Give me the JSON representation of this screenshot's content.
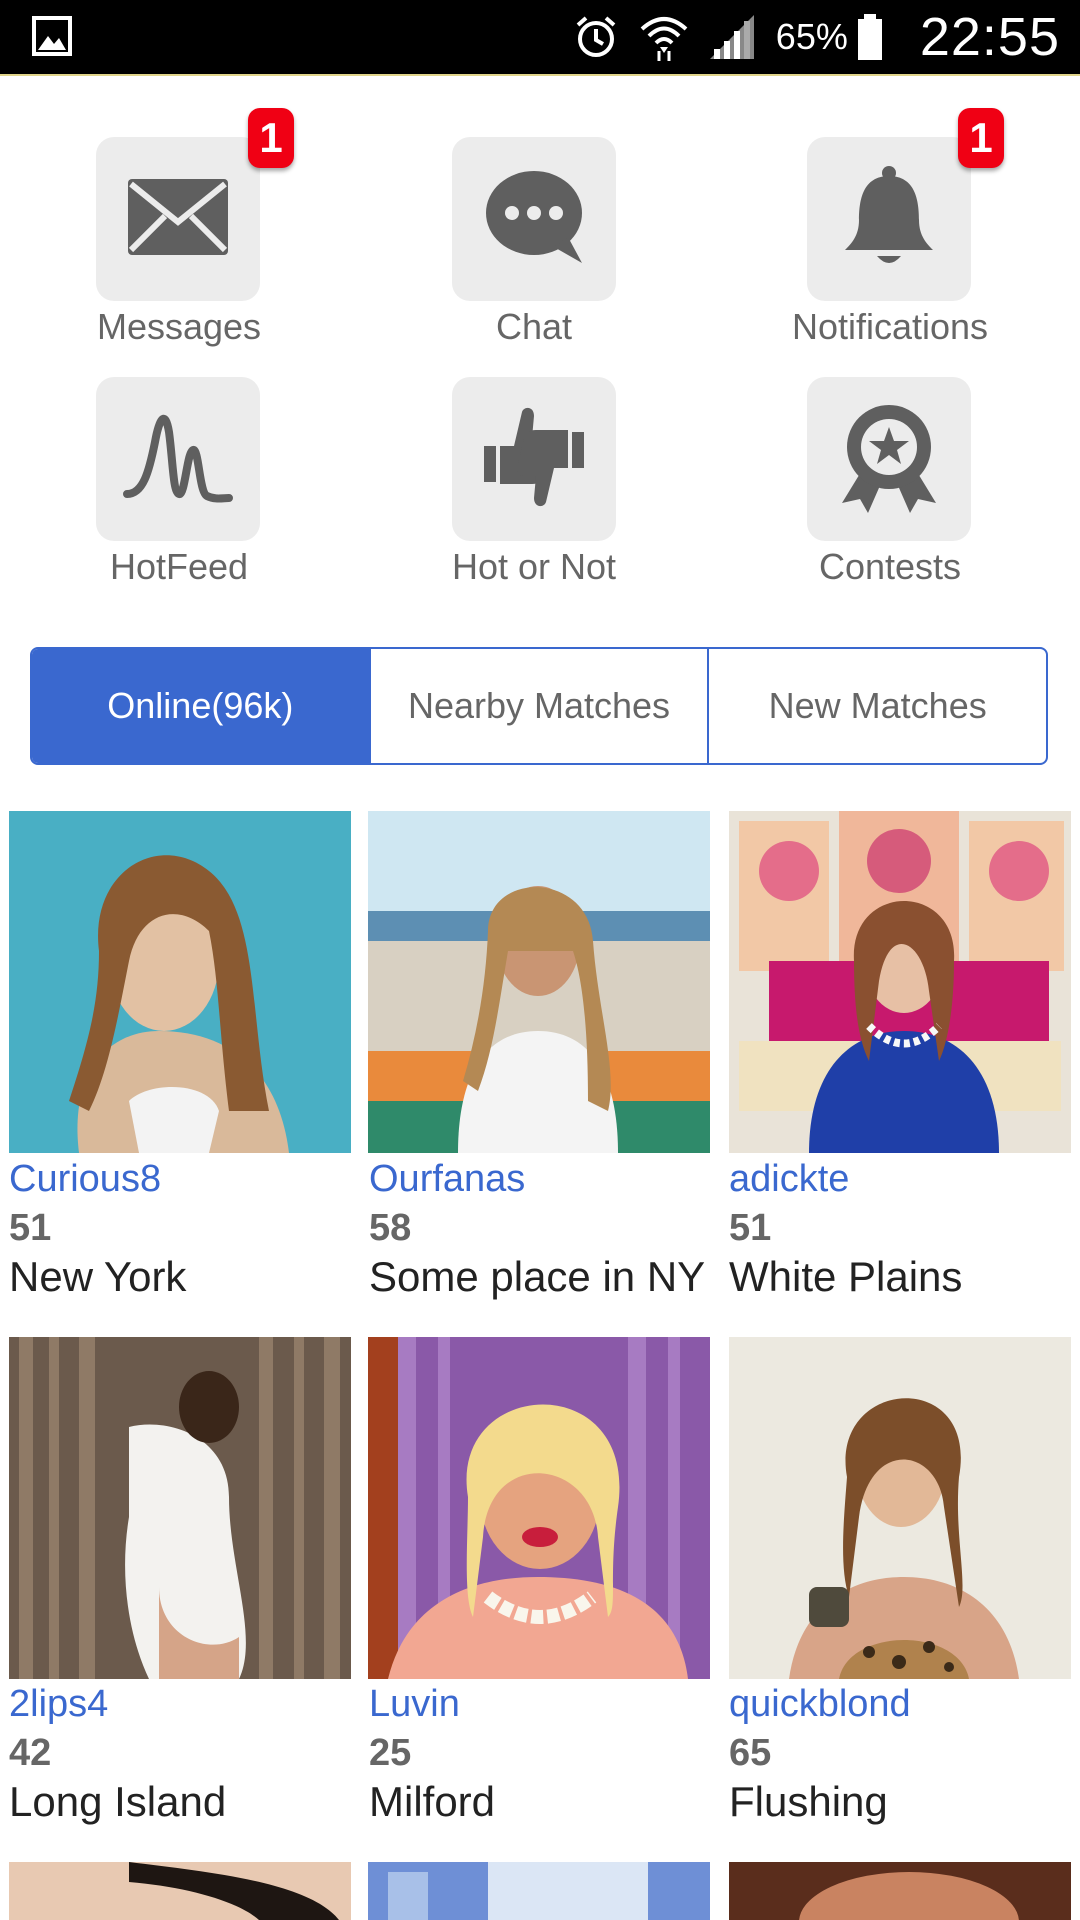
{
  "status_bar": {
    "battery_percent": "65%",
    "time": "22:55",
    "icons": [
      "gallery-icon",
      "alarm-icon",
      "wifi-icon",
      "signal-icon",
      "battery-icon"
    ]
  },
  "menu": {
    "items": [
      {
        "label": "Messages",
        "icon": "envelope-icon",
        "badge": "1"
      },
      {
        "label": "Chat",
        "icon": "chat-bubble-icon",
        "badge": ""
      },
      {
        "label": "Notifications",
        "icon": "bell-icon",
        "badge": "1"
      },
      {
        "label": "HotFeed",
        "icon": "pulse-icon",
        "badge": ""
      },
      {
        "label": "Hot or Not",
        "icon": "thumbs-icon",
        "badge": ""
      },
      {
        "label": "Contests",
        "icon": "award-ribbon-icon",
        "badge": ""
      }
    ]
  },
  "tabs": [
    {
      "label": "Online(96k)",
      "active": true
    },
    {
      "label": "Nearby Matches",
      "active": false
    },
    {
      "label": "New Matches",
      "active": false
    }
  ],
  "profiles": [
    {
      "name": "Curious8",
      "age": "51",
      "city": "New York"
    },
    {
      "name": "Ourfanas",
      "age": "58",
      "city": "Some place in NY"
    },
    {
      "name": "adickte",
      "age": "51",
      "city": "White Plains"
    },
    {
      "name": "2lips4",
      "age": "42",
      "city": "Long Island"
    },
    {
      "name": "Luvin",
      "age": "25",
      "city": "Milford"
    },
    {
      "name": "quickblond",
      "age": "65",
      "city": "Flushing"
    }
  ],
  "colors": {
    "accent": "#3a68cf",
    "badge": "#f00014",
    "tile_bg": "#ececec",
    "icon": "#5f5f5f"
  }
}
